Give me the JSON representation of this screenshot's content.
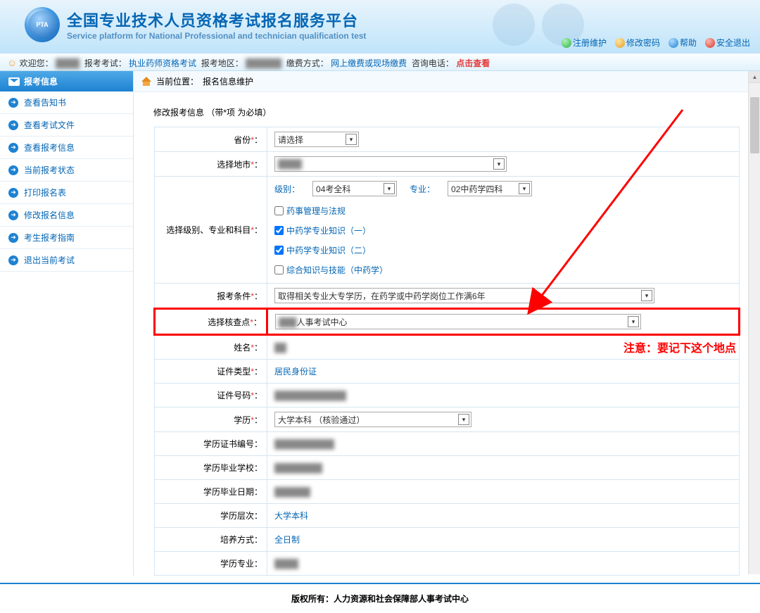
{
  "header": {
    "logo_text": "PTA",
    "title_cn": "全国专业技术人员资格考试报名服务平台",
    "title_en": "Service platform for National Professional and technician qualification test",
    "links": [
      {
        "name": "register-maintain",
        "label": "注册维护"
      },
      {
        "name": "change-password",
        "label": "修改密码"
      },
      {
        "name": "help",
        "label": "帮助"
      },
      {
        "name": "safe-exit",
        "label": "安全退出"
      }
    ]
  },
  "info_bar": {
    "welcome_label": "欢迎您：",
    "exam_label": "报考考试：",
    "exam_value": "执业药师资格考试",
    "region_label": "报考地区：",
    "pay_label": "缴费方式：",
    "pay_value": "网上缴费或现场缴费",
    "tel_label": "咨询电话：",
    "tel_value": "点击查看"
  },
  "sidebar": {
    "header": "报考信息",
    "items": [
      {
        "label": "查看告知书"
      },
      {
        "label": "查看考试文件"
      },
      {
        "label": "查看报考信息"
      },
      {
        "label": "当前报考状态"
      },
      {
        "label": "打印报名表"
      },
      {
        "label": "修改报名信息"
      },
      {
        "label": "考生报考指南"
      },
      {
        "label": "退出当前考试"
      }
    ]
  },
  "breadcrumb": {
    "label": "当前位置：",
    "value": "报名信息维护"
  },
  "form": {
    "title": "修改报考信息  （带*项 为必填）",
    "rows": {
      "province": {
        "label": "省份",
        "value": "请选择"
      },
      "city": {
        "label": "选择地市"
      },
      "levelrow": {
        "label": "选择级别、专业和科目",
        "level_lbl": "级别：",
        "level_val": "04考全科",
        "major_lbl": "专业：",
        "major_val": "02中药学四科"
      },
      "subjects": [
        {
          "label": "药事管理与法规",
          "checked": false
        },
        {
          "label": "中药学专业知识（一）",
          "checked": true
        },
        {
          "label": "中药学专业知识（二）",
          "checked": true
        },
        {
          "label": "综合知识与技能（中药学）",
          "checked": false
        }
      ],
      "condition": {
        "label": "报考条件",
        "value": "取得相关专业大专学历，在药学或中药学岗位工作满6年"
      },
      "checkpoint": {
        "label": "选择核查点",
        "value": "人事考试中心"
      },
      "name": {
        "label": "姓名"
      },
      "idtype": {
        "label": "证件类型",
        "value": "居民身份证"
      },
      "idno": {
        "label": "证件号码"
      },
      "edu": {
        "label": "学历",
        "value": "大学本科 （核验通过）"
      },
      "certno": {
        "label": "学历证书编号"
      },
      "school": {
        "label": "学历毕业学校"
      },
      "graddate": {
        "label": "学历毕业日期"
      },
      "level": {
        "label": "学历层次",
        "value": "大学本科"
      },
      "mode": {
        "label": "培养方式",
        "value": "全日制"
      },
      "major": {
        "label": "学历专业"
      }
    }
  },
  "annotation_text": "注意：要记下这个地点",
  "footer": "版权所有：人力资源和社会保障部人事考试中心"
}
